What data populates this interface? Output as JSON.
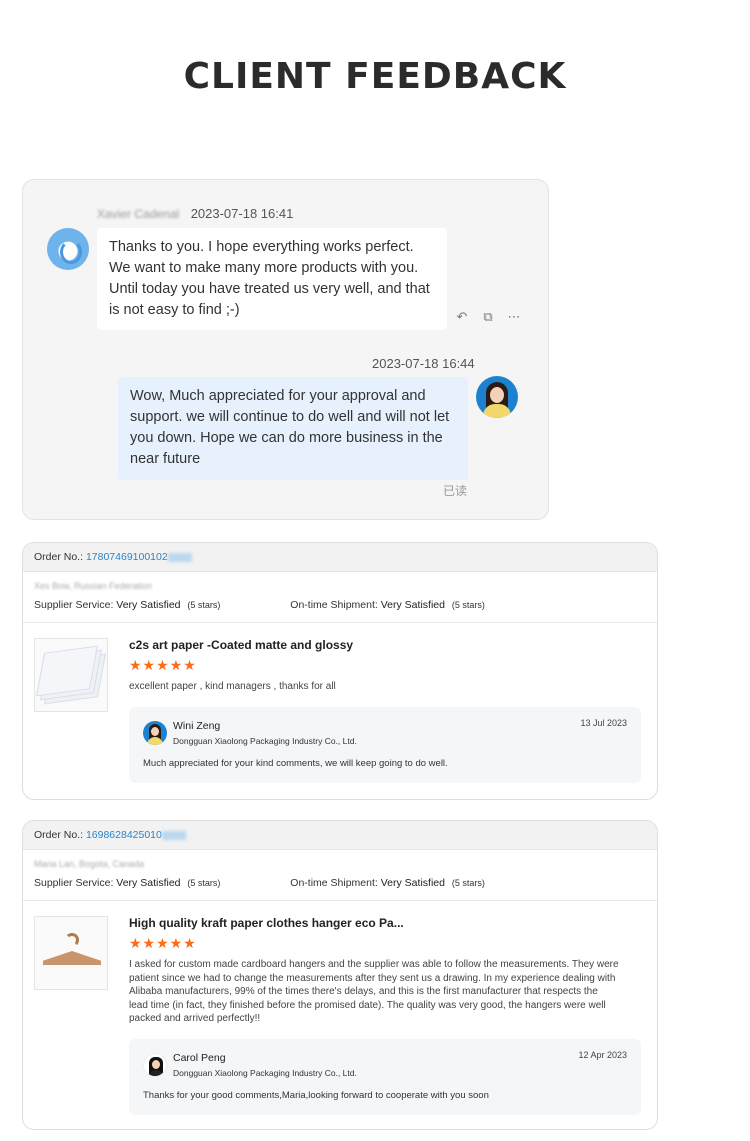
{
  "page": {
    "title": "CLIENT FEEDBACK"
  },
  "chat": {
    "incoming": {
      "sender": "Xavier Cadenal",
      "time": "2023-07-18 16:41",
      "text": "Thanks to you. I hope everything works perfect. We want to make many more products with you. Until today you have treated us very well, and that is not easy to find ;-)"
    },
    "outgoing": {
      "time": "2023-07-18 16:44",
      "text": "Wow, Much appreciated for your approval and support. we will continue to do well and will not let you down. Hope we can do more business in the near future",
      "status": "已读"
    }
  },
  "reviews": [
    {
      "order_label": "Order No.:",
      "order_number": "17807469100102",
      "buyer": "Xes Bow, Russian Federation",
      "supplier_label": "Supplier Service:",
      "supplier_value": "Very Satisfied",
      "supplier_stars": "(5 stars)",
      "shipment_label": "On-time Shipment:",
      "shipment_value": "Very Satisfied",
      "shipment_stars": "(5 stars)",
      "product": "c2s art paper -Coated matte and glossy",
      "stars": "★★★★★",
      "comment": "excellent paper , kind managers , thanks for all",
      "reply": {
        "name": "Wini Zeng",
        "company": "Dongguan Xiaolong Packaging Industry Co., Ltd.",
        "date": "13 Jul 2023",
        "text": "Much appreciated for your kind comments, we will keep going to do well."
      }
    },
    {
      "order_label": "Order No.:",
      "order_number": "1698628425010",
      "buyer": "Maria Lan, Bogota, Canada",
      "supplier_label": "Supplier Service:",
      "supplier_value": "Very Satisfied",
      "supplier_stars": "(5 stars)",
      "shipment_label": "On-time Shipment:",
      "shipment_value": "Very Satisfied",
      "shipment_stars": "(5 stars)",
      "product": "High quality kraft paper clothes hanger eco Pa...",
      "stars": "★★★★★",
      "comment": "I asked for custom made cardboard hangers and the supplier was able to follow the measurements. They were patient since we had to change the measurements after they sent us a drawing. In my experience dealing with Alibaba manufacturers, 99% of the times there's delays, and this is the first manufacturer that respects the lead time (in fact, they finished before the promised date). The quality was very good, the hangers were well packed and arrived perfectly!!",
      "reply": {
        "name": "Carol Peng",
        "company": "Dongguan Xiaolong Packaging Industry Co., Ltd.",
        "date": "12 Apr 2023",
        "text": "Thanks for your good comments,Maria,looking forward to cooperate with you soon"
      }
    }
  ],
  "icons": {
    "reply": "reply-icon",
    "forward": "forward-icon",
    "more": "more-icon",
    "star_color": "#ff6a13",
    "link_color": "#2a84c8"
  }
}
